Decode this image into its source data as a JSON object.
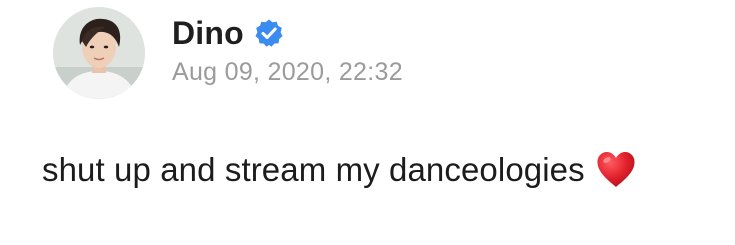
{
  "post": {
    "author": {
      "name": "Dino",
      "verified": true,
      "avatar_icon": "profile-photo",
      "verified_icon": "verified-badge-icon"
    },
    "timestamp": "Aug 09, 2020, 22:32",
    "message": {
      "text": "shut up and stream my danceologies",
      "emoji_icon": "red-heart-icon"
    }
  },
  "colors": {
    "verified_blue": "#3b8cf0",
    "heart_red": "#e0202b",
    "timestamp_gray": "#9b9b9b",
    "text": "#1c1c1c"
  }
}
